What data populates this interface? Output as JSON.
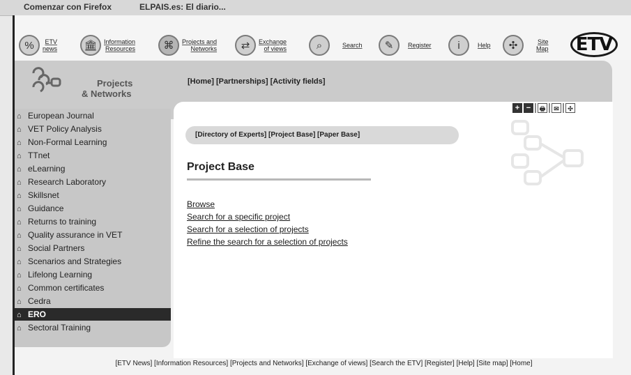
{
  "bookmarks": [
    "Comenzar con Firefox",
    "ELPAIS.es: El diario..."
  ],
  "nav": [
    {
      "icon": "percent-icon",
      "glyph": "%",
      "label": "ETV\nnews"
    },
    {
      "icon": "building-icon",
      "glyph": "🏛",
      "label": "Information\nResources"
    },
    {
      "icon": "network-icon",
      "glyph": "⌘",
      "label": "Projects and\nNetworks"
    },
    {
      "icon": "exchange-icon",
      "glyph": "⇄",
      "label": "Exchange\nof views"
    },
    {
      "icon": "search-icon",
      "glyph": "⌕",
      "label": "Search"
    },
    {
      "icon": "pen-icon",
      "glyph": "✎",
      "label": "Register"
    },
    {
      "icon": "info-icon",
      "glyph": "i",
      "label": "Help"
    },
    {
      "icon": "sitemap-icon",
      "glyph": "✣",
      "label": "Site\nMap"
    }
  ],
  "logo": {
    "text": "ETV"
  },
  "section": {
    "title_line1": "Projects",
    "title_line2": "& Networks"
  },
  "breadcrumb": "[Home] [Partnerships] [Activity fields]",
  "sidebar": [
    "European Journal",
    "VET Policy Analysis",
    "Non-Formal Learning",
    "TTnet",
    "eLearning",
    "Research Laboratory",
    "Skillsnet",
    "Guidance",
    "Returns to training",
    "Quality assurance in VET",
    "Social Partners",
    "Scenarios and Strategies",
    "Lifelong Learning",
    "Common certificates",
    "Cedra",
    "ERO",
    "Sectoral Training"
  ],
  "sidebar_active": "ERO",
  "tools": [
    "+",
    "−",
    "🖶",
    "✉",
    "✣"
  ],
  "subnav": "[Directory of Experts] [Project Base] [Paper Base]",
  "heading": "Project Base",
  "links": [
    "Browse",
    "Search for a specific project",
    "Search for a selection of projects",
    "Refine the search for a selection of projects"
  ],
  "footer": "[ETV News] [Information Resources] [Projects and Networks] [Exchange of views] [Search the ETV] [Register] [Help] [Site map] [Home]"
}
